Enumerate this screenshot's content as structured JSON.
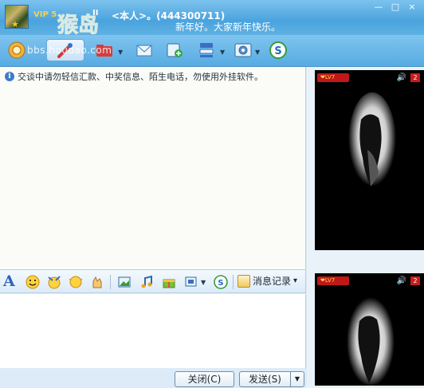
{
  "window": {
    "contact_name": "<本人>。(444300711)",
    "signature": "新年好。大家新年快乐。",
    "min_label": "—",
    "max_label": "□",
    "close_label": "×"
  },
  "watermark": {
    "logo_text": "猴岛",
    "url": "bbs.houdao.com",
    "user_text": "VIP 5",
    "pause_text": "II"
  },
  "toolbar": {
    "items": [
      "video-call",
      "voice-call",
      "file-transfer",
      "send-sms",
      "create-group",
      "more-apps",
      "settings",
      "qq-wallet"
    ]
  },
  "chat": {
    "notice": "交谈中请勿轻信汇款、中奖信息、陌生电话，勿使用外挂软件。",
    "info_icon_glyph": "i"
  },
  "video": {
    "badge_prefix": "❤",
    "badge_level": "LV7",
    "speaker_icon": "speaker-icon",
    "count": "2"
  },
  "format_bar": {
    "font_glyph": "A",
    "history_label": "消息记录",
    "history_arrow": "▾"
  },
  "input": {
    "placeholder": ""
  },
  "buttons": {
    "close_label": "关闭(C)",
    "send_label": "发送(S)",
    "send_drop": "▼"
  }
}
